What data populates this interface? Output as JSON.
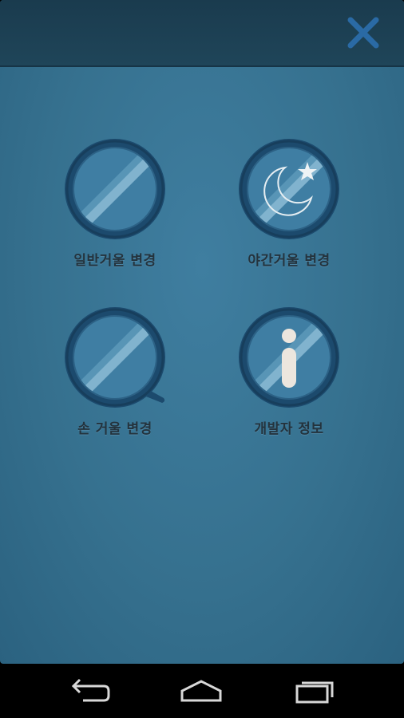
{
  "menu": {
    "items": [
      {
        "label": "일반거울 변경",
        "icon": "mirror-normal-icon"
      },
      {
        "label": "야간거울 변경",
        "icon": "mirror-night-icon"
      },
      {
        "label": "손 거울 변경",
        "icon": "mirror-hand-icon"
      },
      {
        "label": "개발자 정보",
        "icon": "info-icon"
      }
    ]
  },
  "header": {
    "close_icon": "close-icon"
  },
  "navbar": {
    "back_icon": "back-icon",
    "home_icon": "home-icon",
    "recents_icon": "recents-icon"
  },
  "colors": {
    "background": "#36718f",
    "topbar": "#1d4256",
    "ring": "#1f4d72",
    "label": "#24333d"
  }
}
